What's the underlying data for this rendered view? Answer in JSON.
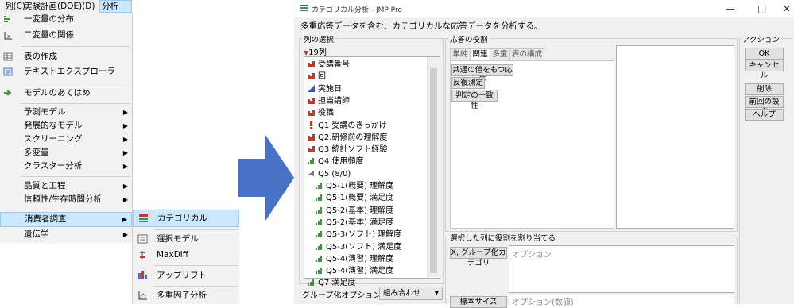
{
  "menubar": {
    "items": [
      "列(C)",
      "実験計画(DOE)(D)",
      "分析(A)"
    ]
  },
  "menu": {
    "items": [
      {
        "label": "一変量の分布",
        "icon": "histogram-icon",
        "submenu": false
      },
      {
        "label": "二変量の関係",
        "icon": "fit-y-by-x-icon",
        "submenu": false
      },
      {
        "label": "表の作成",
        "icon": "table-icon",
        "submenu": false
      },
      {
        "label": "テキストエクスプローラ",
        "icon": "text-explorer-icon",
        "submenu": false
      },
      {
        "label": "モデルのあてはめ",
        "icon": "fit-model-icon",
        "submenu": false
      },
      {
        "label": "予測モデル",
        "submenu": true
      },
      {
        "label": "発展的なモデル",
        "submenu": true
      },
      {
        "label": "スクリーニング",
        "submenu": true
      },
      {
        "label": "多変量",
        "submenu": true
      },
      {
        "label": "クラスター分析",
        "submenu": true
      },
      {
        "label": "品質と工程",
        "submenu": true
      },
      {
        "label": "信頼性/生存時間分析",
        "submenu": true
      },
      {
        "label": "消費者調査",
        "submenu": true
      },
      {
        "label": "遺伝学",
        "submenu": true
      }
    ]
  },
  "submenu": {
    "items": [
      {
        "label": "カテゴリカル",
        "icon": "categorical-icon"
      },
      {
        "label": "選択モデル",
        "icon": "choice-icon"
      },
      {
        "label": "MaxDiff",
        "icon": "maxdiff-icon"
      },
      {
        "label": "アップリフト",
        "icon": "uplift-icon"
      },
      {
        "label": "多重因子分析",
        "icon": "multiple-factor-icon"
      }
    ]
  },
  "dialog": {
    "title": "カテゴリカル分析 - JMP Pro",
    "description": "多重応答データを含む、カテゴリカルな応答データを分析する。",
    "column_select": {
      "title": "列の選択",
      "count": "19列",
      "columns": [
        {
          "label": "受講番号",
          "type": "nominal"
        },
        {
          "label": "回",
          "type": "nominal"
        },
        {
          "label": "実施日",
          "type": "continuous"
        },
        {
          "label": "担当講師",
          "type": "nominal"
        },
        {
          "label": "役職",
          "type": "nominal"
        },
        {
          "label": "Q1 受講のきっかけ",
          "type": "multiple"
        },
        {
          "label": "Q2.研修前の理解度",
          "type": "nominal"
        },
        {
          "label": "Q3 統計ソフト経験",
          "type": "nominal"
        },
        {
          "label": "Q4 使用頻度",
          "type": "ordinal"
        },
        {
          "label": "Q5 (8/0)",
          "type": "group"
        },
        {
          "label": "Q5-1(概要) 理解度",
          "type": "ordinal"
        },
        {
          "label": "Q5-1(概要) 満足度",
          "type": "ordinal"
        },
        {
          "label": "Q5-2(基本) 理解度",
          "type": "ordinal"
        },
        {
          "label": "Q5-2(基本) 満足度",
          "type": "ordinal"
        },
        {
          "label": "Q5-3(ソフト) 理解度",
          "type": "ordinal"
        },
        {
          "label": "Q5-3(ソフト) 満足度",
          "type": "ordinal"
        },
        {
          "label": "Q5-4(演習) 理解度",
          "type": "ordinal"
        },
        {
          "label": "Q5-4(演習) 満足度",
          "type": "ordinal"
        },
        {
          "label": "Q7 満足度",
          "type": "ordinal"
        }
      ]
    },
    "response_roles": {
      "title": "応答の役割",
      "tabs": [
        "単純",
        "関連",
        "多重",
        "表の構成"
      ],
      "active_tab": 1,
      "buttons": [
        "共通の値をもつ応答",
        "反復測定",
        "判定の一致性"
      ]
    },
    "assign_roles": {
      "title": "選択した列に役割を割り当てる",
      "rows": [
        {
          "button": "X, グループ化カテゴリ",
          "placeholder": "オプション"
        },
        {
          "button": "標本サイズ",
          "placeholder": "オプション(数値)"
        }
      ]
    },
    "grouping": {
      "label": "グループ化オプション",
      "selected": "組み合わせ"
    },
    "actions": {
      "title": "アクション",
      "buttons": [
        "OK",
        "キャンセル",
        "削除",
        "前回の設定",
        "ヘルプ"
      ]
    },
    "window_controls": [
      "—",
      "□",
      "✕"
    ]
  },
  "colors": {
    "selection_bg": "#cce8ff",
    "nominal": "#c0392b",
    "continuous": "#2c5fb5",
    "ordinal": "#3a9a3a",
    "arrow": "#4a72c4"
  }
}
